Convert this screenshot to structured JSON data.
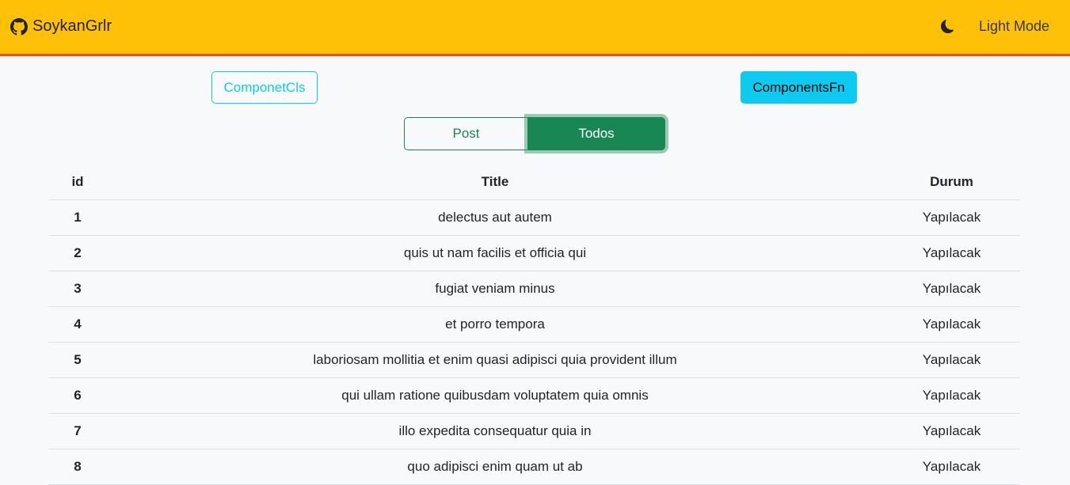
{
  "navbar": {
    "brand": "SoykanGrlr",
    "brand_icon": "github-icon",
    "theme_icon": "moon-icon",
    "mode_label": "Light Mode",
    "bg_color": "#ffc107",
    "border_color": "#ee4d1a"
  },
  "components": {
    "cls_label": "ComponetCls",
    "fn_label": "ComponentsFn"
  },
  "toggle": {
    "post_label": "Post",
    "todos_label": "Todos",
    "active": "Todos"
  },
  "table": {
    "headers": [
      "id",
      "Title",
      "Durum"
    ],
    "rows": [
      {
        "id": "1",
        "title": "delectus aut autem",
        "durum": "Yapılacak"
      },
      {
        "id": "2",
        "title": "quis ut nam facilis et officia qui",
        "durum": "Yapılacak"
      },
      {
        "id": "3",
        "title": "fugiat veniam minus",
        "durum": "Yapılacak"
      },
      {
        "id": "4",
        "title": "et porro tempora",
        "durum": "Yapılacak"
      },
      {
        "id": "5",
        "title": "laboriosam mollitia et enim quasi adipisci quia provident illum",
        "durum": "Yapılacak"
      },
      {
        "id": "6",
        "title": "qui ullam ratione quibusdam voluptatem quia omnis",
        "durum": "Yapılacak"
      },
      {
        "id": "7",
        "title": "illo expedita consequatur quia in",
        "durum": "Yapılacak"
      },
      {
        "id": "8",
        "title": "quo adipisci enim quam ut ab",
        "durum": "Yapılacak"
      }
    ]
  }
}
